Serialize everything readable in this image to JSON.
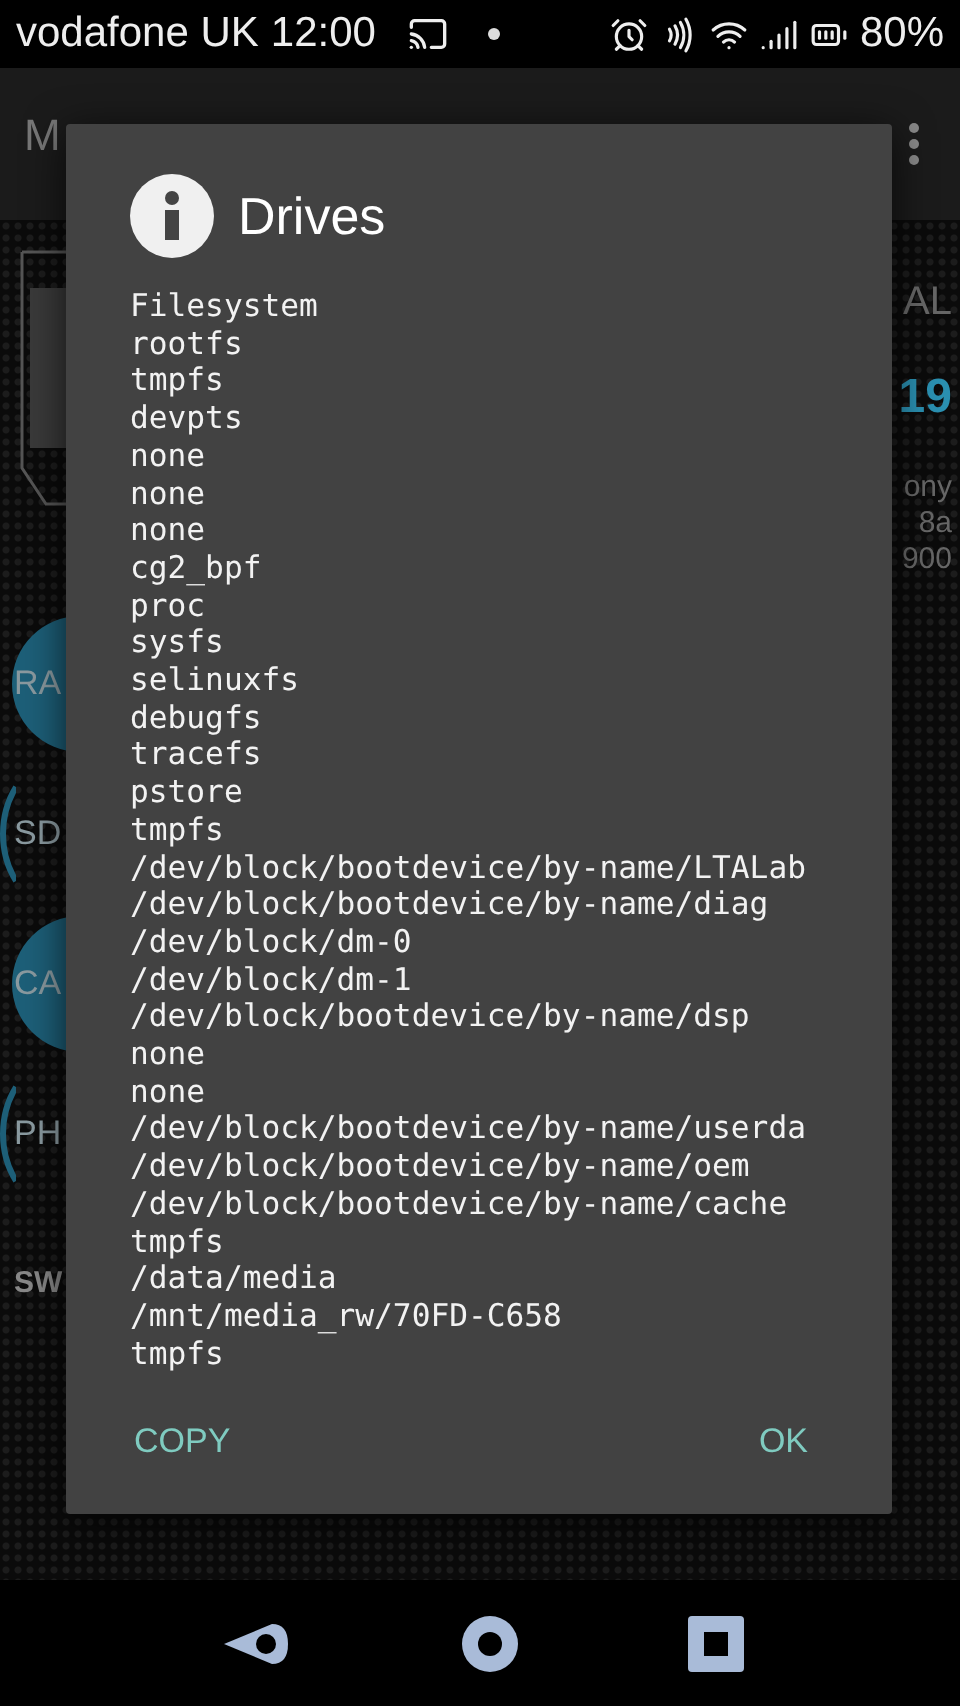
{
  "status_bar": {
    "carrier": "vodafone UK",
    "time": "12:00",
    "battery": "80%"
  },
  "app_bar": {
    "title": "M"
  },
  "left_items": [
    {
      "label": "RA",
      "kind": "large"
    },
    {
      "label": "SD",
      "kind": "small"
    },
    {
      "label": "CA",
      "kind": "large"
    },
    {
      "label": "PH",
      "kind": "small"
    },
    {
      "label": "SW",
      "kind": "plain"
    }
  ],
  "right_texts": [
    {
      "text": "AL",
      "kind": "label"
    },
    {
      "text": "19",
      "kind": "value"
    },
    {
      "text": "ony",
      "kind": "detail"
    },
    {
      "text": "8a",
      "kind": "detail"
    },
    {
      "text": "900",
      "kind": "detail"
    }
  ],
  "dialog": {
    "title": "Drives",
    "lines": [
      "Filesystem",
      "rootfs",
      "tmpfs",
      "devpts",
      "none",
      "none",
      "none",
      "cg2_bpf",
      "proc",
      "sysfs",
      "selinuxfs",
      "debugfs",
      "tracefs",
      "pstore",
      "tmpfs",
      "/dev/block/bootdevice/by-name/LTALab",
      "/dev/block/bootdevice/by-name/diag",
      "/dev/block/dm-0",
      "/dev/block/dm-1",
      "/dev/block/bootdevice/by-name/dsp",
      "none",
      "none",
      "/dev/block/bootdevice/by-name/userda",
      "/dev/block/bootdevice/by-name/oem",
      "/dev/block/bootdevice/by-name/cache",
      "tmpfs",
      "/data/media",
      "/mnt/media_rw/70FD-C658",
      "tmpfs"
    ],
    "buttons": [
      "COPY",
      "OK"
    ]
  }
}
